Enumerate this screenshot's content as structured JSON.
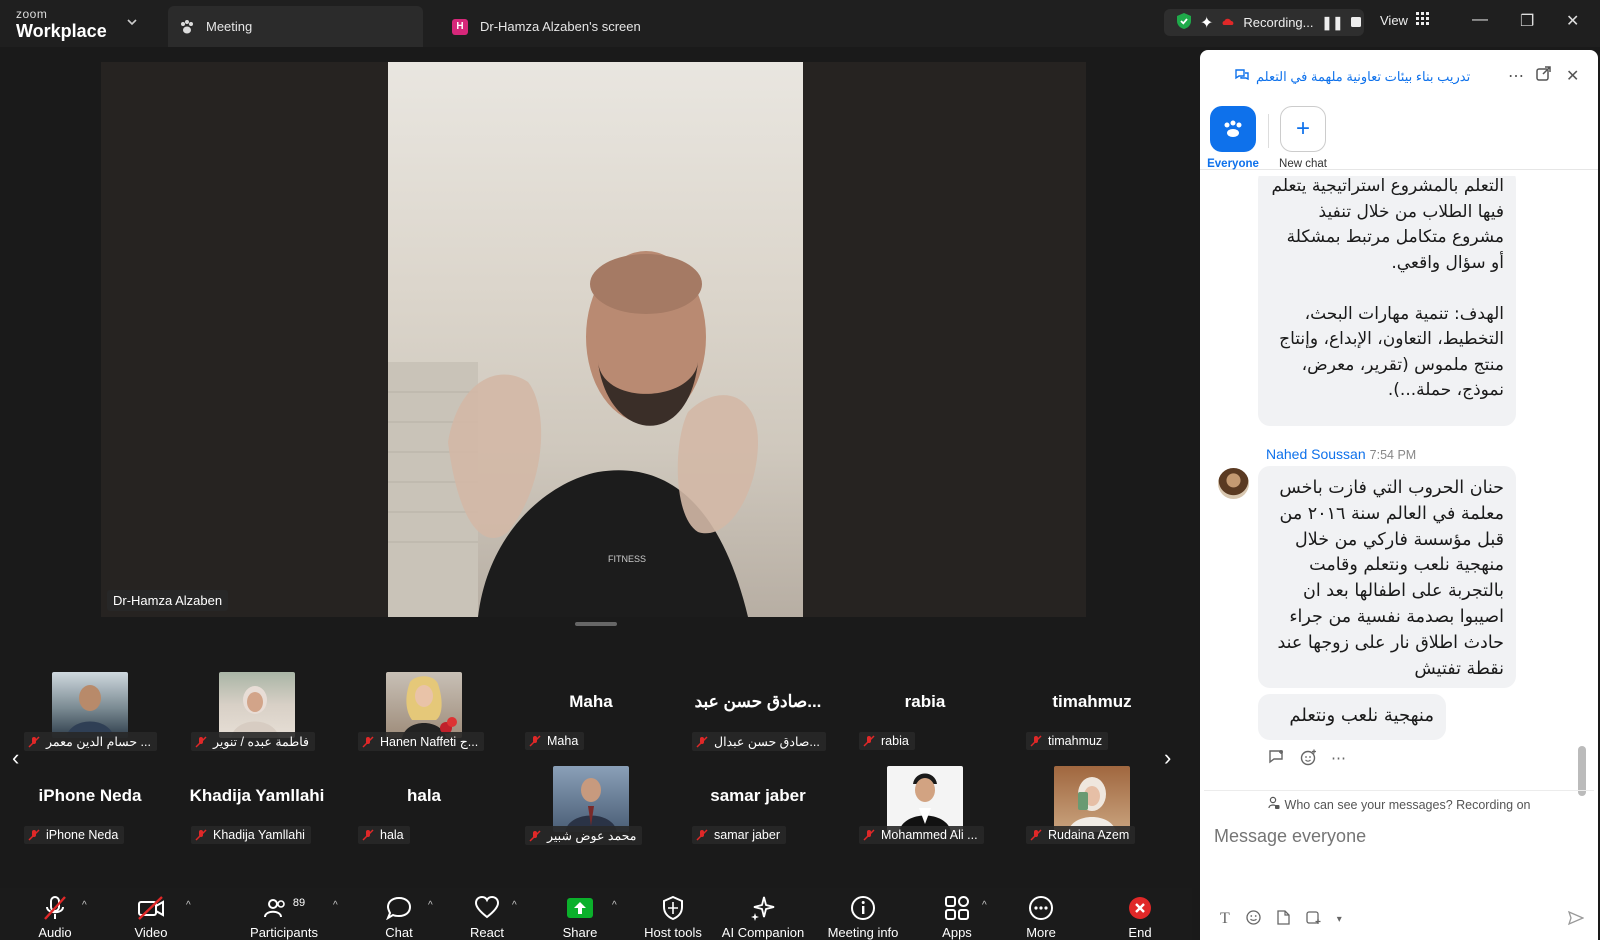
{
  "app": {
    "brand_small": "zoom",
    "brand_big": "Workplace",
    "tabs": [
      {
        "label": "Meeting"
      },
      {
        "badge": "H",
        "label": "Dr-Hamza Alzaben's screen"
      }
    ],
    "recording_label": "Recording...",
    "view_label": "View"
  },
  "video": {
    "speaker_name": "Dr-Hamza Alzaben"
  },
  "gallery": {
    "row1": [
      {
        "big": "",
        "label": "حسام الدين معمر ...",
        "has_video": true
      },
      {
        "big": "",
        "label": "فاطمة عبده / تنوير",
        "has_video": true
      },
      {
        "big": "",
        "label": "Hanen Naffeti ج...",
        "has_video": true
      },
      {
        "big": "Maha",
        "label": "Maha",
        "has_video": false
      },
      {
        "big": "صادق حسن عبد...",
        "label": "صادق حسن عبدال...",
        "has_video": false
      },
      {
        "big": "rabia",
        "label": "rabia",
        "has_video": false
      },
      {
        "big": "timahmuz",
        "label": "timahmuz",
        "has_video": false
      }
    ],
    "row2": [
      {
        "big": "iPhone Neda",
        "label": "iPhone Neda",
        "has_video": false
      },
      {
        "big": "Khadija Yamllahi",
        "label": "Khadija Yamllahi",
        "has_video": false
      },
      {
        "big": "hala",
        "label": "hala",
        "has_video": false
      },
      {
        "big": "",
        "label": "محمد عوض شبير",
        "has_video": true
      },
      {
        "big": "samar jaber",
        "label": "samar jaber",
        "has_video": false
      },
      {
        "big": "",
        "label": "Mohammed Ali ...",
        "has_video": true
      },
      {
        "big": "",
        "label": "Rudaina Azem",
        "has_video": true
      }
    ]
  },
  "toolbar": {
    "audio": "Audio",
    "video": "Video",
    "participants": "Participants",
    "participants_count": "89",
    "chat": "Chat",
    "react": "React",
    "share": "Share",
    "host_tools": "Host tools",
    "ai_companion": "AI Companion",
    "meeting_info": "Meeting info",
    "apps": "Apps",
    "more": "More",
    "end": "End"
  },
  "chat": {
    "title": "تدريب بناء بيئات تعاونية ملهمة في التعلم",
    "tab_everyone": "Everyone",
    "tab_new_chat": "New chat",
    "message1": "التعلم بالمشروع استراتيجية يتعلم فيها الطلاب من خلال تنفيذ مشروع متكامل مرتبط بمشكلة أو سؤال واقعي.\n\nالهدف: تنمية مهارات البحث، التخطيط، التعاون، الإبداع، وإنتاج منتج ملموس (تقرير، معرض، نموذج، حملة...).",
    "sender": "Nahed Soussan",
    "sender_time": "7:54 PM",
    "message2": "حنان الحروب التي فازت باخس معلمة في العالم سنة ٢٠١٦ من قبل مؤسسة فاركي  من خلال منهجية نلعب ونتعلم وقامت بالتجربة على اطفالها بعد ان اصيبوا بصدمة نفسية من جراء حادث اطلاق نار على زوجها عند نقطة تفتيش",
    "message3": "منهجية نلعب ونتعلم",
    "privacy_note": "Who can see your messages? Recording on",
    "input_placeholder": "Message everyone"
  },
  "colors": {
    "accent": "#0e71eb",
    "record_red": "#e02828",
    "share_green": "#0bb02b",
    "end_red": "#e02828"
  }
}
